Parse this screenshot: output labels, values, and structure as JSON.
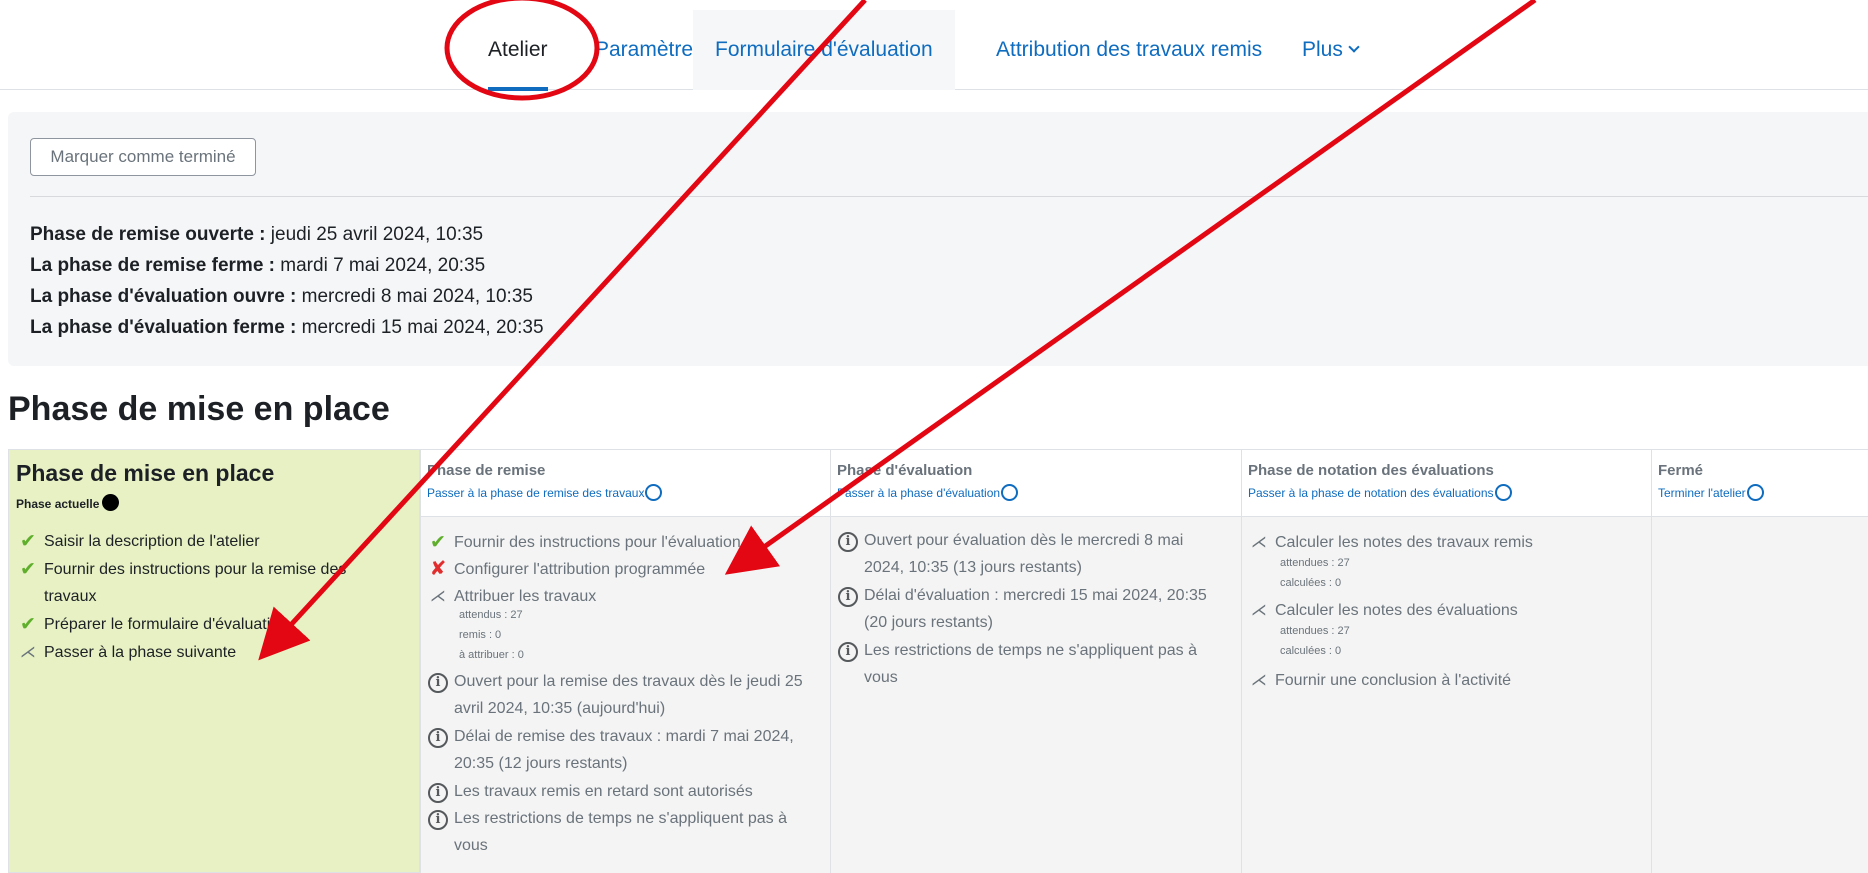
{
  "nav": {
    "tabs": [
      {
        "label": "Atelier"
      },
      {
        "label": "Paramètres"
      },
      {
        "label": "Formulaire d'évaluation"
      },
      {
        "label": "Attribution des travaux remis"
      },
      {
        "label": "Plus"
      }
    ]
  },
  "panel": {
    "mark_button": "Marquer comme terminé",
    "dates": [
      {
        "label": "Phase de remise ouverte :",
        "value": " jeudi 25 avril 2024, 10:35"
      },
      {
        "label": "La phase de remise ferme :",
        "value": " mardi 7 mai 2024, 20:35"
      },
      {
        "label": "La phase d'évaluation ouvre :",
        "value": " mercredi 8 mai 2024, 10:35"
      },
      {
        "label": "La phase d'évaluation ferme :",
        "value": " mercredi 15 mai 2024, 20:35"
      }
    ]
  },
  "heading": "Phase de mise en place",
  "planner": {
    "setup": {
      "title": "Phase de mise en place",
      "current_label": "Phase actuelle",
      "tasks": [
        {
          "text": "Saisir la description de l'atelier"
        },
        {
          "text": "Fournir des instructions pour la remise des travaux"
        },
        {
          "text": "Préparer le formulaire d'évaluation"
        },
        {
          "text": "Passer à la phase suivante"
        }
      ]
    },
    "submission": {
      "title": "Phase de remise",
      "link": "Passer à la phase de remise des travaux",
      "tasks": [
        {
          "text": "Fournir des instructions pour l'évaluation"
        },
        {
          "text": "Configurer l'attribution programmée"
        },
        {
          "text": "Attribuer les travaux"
        },
        {
          "text": "Ouvert pour la remise des travaux dès le jeudi 25 avril 2024, 10:35 (aujourd'hui)"
        },
        {
          "text": "Délai de remise des travaux : mardi 7 mai 2024, 20:35 (12 jours restants)"
        },
        {
          "text": "Les travaux remis en retard sont autorisés"
        },
        {
          "text": "Les restrictions de temps ne s'appliquent pas à vous"
        }
      ],
      "stats": [
        "attendus : 27",
        "remis : 0",
        "à attribuer : 0"
      ]
    },
    "assessment": {
      "title": "Phase d'évaluation",
      "link": "Passer à la phase d'évaluation",
      "tasks": [
        {
          "text": "Ouvert pour évaluation dès le mercredi 8 mai 2024, 10:35 (13 jours restants)"
        },
        {
          "text": "Délai d'évaluation : mercredi 15 mai 2024, 20:35 (20 jours restants)"
        },
        {
          "text": "Les restrictions de temps ne s'appliquent pas à vous"
        }
      ]
    },
    "grading": {
      "title": "Phase de notation des évaluations",
      "link": "Passer à la phase de notation des évaluations",
      "tasks": [
        {
          "text": "Calculer les notes des travaux remis"
        },
        {
          "text": "Calculer les notes des évaluations"
        },
        {
          "text": "Fournir une conclusion à l'activité"
        }
      ],
      "stats1": [
        "attendues : 27",
        "calculées : 0"
      ],
      "stats2": [
        "attendues : 27",
        "calculées : 0"
      ]
    },
    "closed": {
      "title": "Fermé",
      "link": "Terminer l'atelier"
    }
  },
  "colors": {
    "accent": "#0f6cbf",
    "current_phase_bg": "#e7f1c3",
    "annotation": "#e30613",
    "done": "#5fae2c",
    "fail": "#e12d2d"
  },
  "icons": [
    "check-icon",
    "cross-icon",
    "todo-icon",
    "info-icon",
    "chevron-down-icon",
    "circle-icon",
    "dot-icon"
  ]
}
